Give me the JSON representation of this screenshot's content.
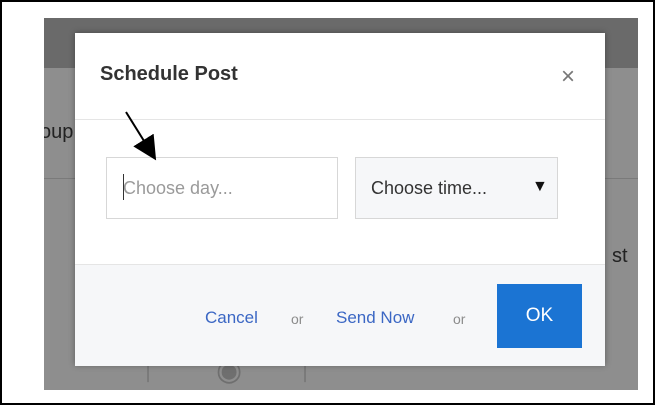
{
  "dialog": {
    "title": "Schedule Post",
    "close_glyph": "×",
    "day_input": {
      "value": "",
      "placeholder": "Choose day..."
    },
    "time_select": {
      "selected": "Choose time...",
      "arrow_glyph": "▼"
    },
    "footer": {
      "cancel_label": "Cancel",
      "or_1": "or",
      "send_now_label": "Send Now",
      "or_2": "or",
      "ok_label": "OK"
    }
  },
  "background": {
    "left_partial_text": "oup",
    "right_partial_text": "st"
  },
  "colors": {
    "link": "#3b67c4",
    "ok_button": "#1b74d3",
    "overlay": "#8e8e8e"
  },
  "icons": {
    "close": "close-icon",
    "dropdown": "dropdown-arrow-icon",
    "annotation": "annotation-arrow-icon"
  }
}
